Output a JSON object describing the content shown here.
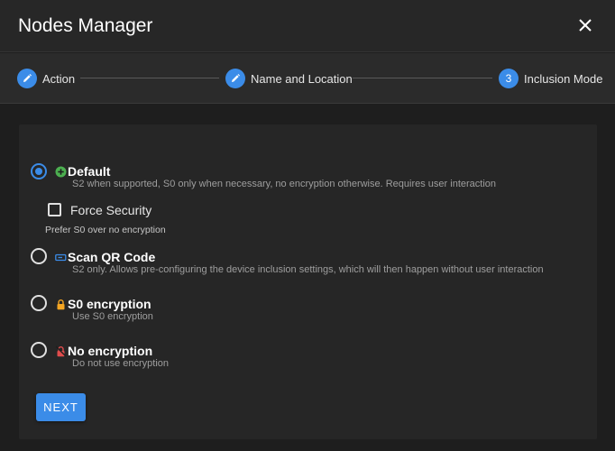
{
  "dialog": {
    "title": "Nodes Manager"
  },
  "stepper": {
    "steps": [
      {
        "label": "Action",
        "state": "edit"
      },
      {
        "label": "Name and Location",
        "state": "edit"
      },
      {
        "label": "Inclusion Mode",
        "number": "3",
        "state": "active"
      }
    ]
  },
  "options": [
    {
      "title": "Default",
      "description": "S2 when supported, S0 only when necessary, no encryption otherwise. Requires user interaction",
      "selected": true,
      "icon": "plus-circle-icon"
    },
    {
      "title": "Scan QR Code",
      "description": "S2 only. Allows pre-configuring the device inclusion settings, which will then happen without user interaction",
      "selected": false,
      "icon": "qrcode-icon"
    },
    {
      "title": "S0 encryption",
      "description": "Use S0 encryption",
      "selected": false,
      "icon": "lock-icon"
    },
    {
      "title": "No encryption",
      "description": "Do not use encryption",
      "selected": false,
      "icon": "lock-off-icon"
    }
  ],
  "force_security": {
    "label": "Force Security",
    "hint": "Prefer S0 over no encryption",
    "checked": false
  },
  "next_button": {
    "label": "NEXT"
  },
  "colors": {
    "accent": "#3b8ce8",
    "green": "#4caf50",
    "orange": "#f5a623",
    "red": "#e04c4c"
  }
}
